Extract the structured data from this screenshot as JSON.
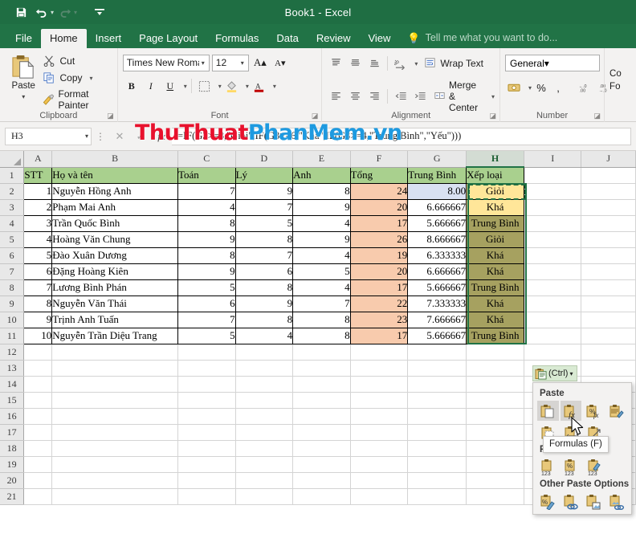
{
  "window": {
    "title": "Book1 - Excel",
    "quick_access": [
      {
        "name": "save-icon",
        "glyph": "💾"
      },
      {
        "name": "undo-icon",
        "glyph": "↶"
      },
      {
        "name": "redo-icon",
        "glyph": "↷"
      },
      {
        "name": "customize-qat-icon",
        "glyph": "≡"
      }
    ]
  },
  "ribbon": {
    "tabs": [
      {
        "label": "File",
        "active": false
      },
      {
        "label": "Home",
        "active": true
      },
      {
        "label": "Insert",
        "active": false
      },
      {
        "label": "Page Layout",
        "active": false
      },
      {
        "label": "Formulas",
        "active": false
      },
      {
        "label": "Data",
        "active": false
      },
      {
        "label": "Review",
        "active": false
      },
      {
        "label": "View",
        "active": false
      }
    ],
    "tell_me": "Tell me what you want to do...",
    "groups": {
      "clipboard": {
        "label": "Clipboard",
        "paste_label": "Paste",
        "cut_label": "Cut",
        "copy_label": "Copy",
        "format_painter_label": "Format Painter"
      },
      "font": {
        "label": "Font",
        "font_name": "Times New Roma",
        "font_size": "12",
        "bold_label": "B",
        "italic_label": "I",
        "underline_label": "U"
      },
      "alignment": {
        "label": "Alignment",
        "wrap_text_label": "Wrap Text",
        "merge_center_label": "Merge & Center"
      },
      "number": {
        "label": "Number",
        "format_value": "General",
        "percent_label": "%",
        "comma_label": "̦",
        "increase_decimal": ".00",
        "decrease_decimal": ".00"
      },
      "cells": {
        "line1": "Co",
        "line2": "Fo"
      }
    }
  },
  "watermark": {
    "part1": "ThuThuat",
    "part2": "PhanMem",
    "part3": ".vn",
    "color1": "#e8112d",
    "color2": "#1e9ae0"
  },
  "formula_bar": {
    "name_box": "H3",
    "cancel_icon": "✕",
    "enter_icon": "✓",
    "function_icon": "fx",
    "formula": "=IF(G3>=8,\"Giỏi\",IF(G3>=6,\"Khá\",IF(G3>=4,\"Trung Bình\",\"Yếu\")))"
  },
  "sheet": {
    "column_headers": [
      "A",
      "B",
      "C",
      "D",
      "E",
      "F",
      "G",
      "H",
      "I",
      "J"
    ],
    "selected_column": "H",
    "row_headers": [
      "1",
      "2",
      "3",
      "4",
      "5",
      "6",
      "7",
      "8",
      "9",
      "10",
      "11",
      "12",
      "13",
      "14",
      "15",
      "16",
      "17",
      "18",
      "19",
      "20",
      "21"
    ],
    "table_headers": [
      "STT",
      "Họ và tên",
      "Toán",
      "Lý",
      "Anh",
      "Tổng",
      "Trung Bình",
      "Xếp loại"
    ],
    "rows": [
      {
        "stt": "1",
        "name": "Nguyễn Hồng Anh",
        "toan": "7",
        "ly": "9",
        "anh": "8",
        "tong": "24",
        "tb": "8.00",
        "xeploai": "Giỏi"
      },
      {
        "stt": "2",
        "name": "Phạm Mai Anh",
        "toan": "4",
        "ly": "7",
        "anh": "9",
        "tong": "20",
        "tb": "6.666667",
        "xeploai": "Khá"
      },
      {
        "stt": "3",
        "name": "Trần Quốc Bình",
        "toan": "8",
        "ly": "5",
        "anh": "4",
        "tong": "17",
        "tb": "5.666667",
        "xeploai": "Trung Bình"
      },
      {
        "stt": "4",
        "name": "Hoàng Văn Chung",
        "toan": "9",
        "ly": "8",
        "anh": "9",
        "tong": "26",
        "tb": "8.666667",
        "xeploai": "Giỏi"
      },
      {
        "stt": "5",
        "name": "Đào Xuân Dương",
        "toan": "8",
        "ly": "7",
        "anh": "4",
        "tong": "19",
        "tb": "6.333333",
        "xeploai": "Khá"
      },
      {
        "stt": "6",
        "name": "Đặng Hoàng Kiên",
        "toan": "9",
        "ly": "6",
        "anh": "5",
        "tong": "20",
        "tb": "6.666667",
        "xeploai": "Khá"
      },
      {
        "stt": "7",
        "name": "Lương Bình Phán",
        "toan": "5",
        "ly": "8",
        "anh": "4",
        "tong": "17",
        "tb": "5.666667",
        "xeploai": "Trung Bình"
      },
      {
        "stt": "8",
        "name": "Nguyễn Văn Thái",
        "toan": "6",
        "ly": "9",
        "anh": "7",
        "tong": "22",
        "tb": "7.333333",
        "xeploai": "Khá"
      },
      {
        "stt": "9",
        "name": "Trịnh Anh Tuấn",
        "toan": "7",
        "ly": "8",
        "anh": "8",
        "tong": "23",
        "tb": "7.666667",
        "xeploai": "Khá"
      },
      {
        "stt": "10",
        "name": "Nguyễn Trần Diệu Trang",
        "toan": "5",
        "ly": "4",
        "anh": "8",
        "tong": "17",
        "tb": "5.666667",
        "xeploai": "Trung Bình"
      }
    ]
  },
  "paste_options": {
    "badge_label": "(Ctrl)",
    "badge_caret": "▾",
    "section_paste": "Paste",
    "section_paste_values": "Paste Values",
    "section_other": "Other Paste Options",
    "tooltip": "Formulas (F)",
    "paste_icons": [
      {
        "name": "paste-all-icon"
      },
      {
        "name": "paste-formulas-icon"
      },
      {
        "name": "paste-formulas-number-formatting-icon"
      },
      {
        "name": "paste-keep-source-formatting-icon"
      },
      {
        "name": "paste-no-borders-icon"
      },
      {
        "name": "paste-keep-source-column-widths-icon"
      },
      {
        "name": "paste-transpose-icon"
      }
    ],
    "paste_values_icons": [
      {
        "name": "paste-values-icon"
      },
      {
        "name": "paste-values-number-formatting-icon"
      },
      {
        "name": "paste-values-source-formatting-icon"
      }
    ],
    "other_icons": [
      {
        "name": "paste-formatting-icon"
      },
      {
        "name": "paste-link-icon"
      },
      {
        "name": "paste-picture-icon"
      },
      {
        "name": "paste-linked-picture-icon"
      }
    ]
  }
}
